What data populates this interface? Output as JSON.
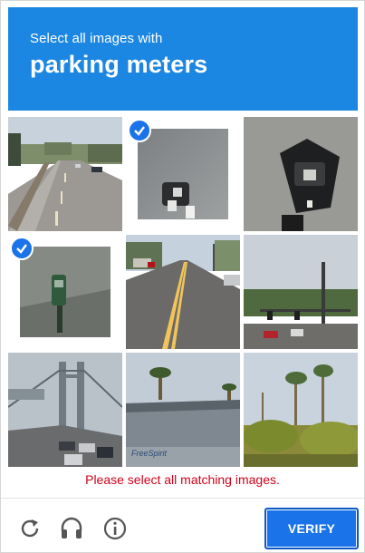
{
  "header": {
    "instruction": "Select all images with",
    "target": "parking meters",
    "background_color": "#1c87e2"
  },
  "tiles": [
    {
      "row": 1,
      "col": 1,
      "subject": "road with parked cars",
      "selected": false
    },
    {
      "row": 1,
      "col": 2,
      "subject": "parking meter close-up",
      "selected": true
    },
    {
      "row": 1,
      "col": 3,
      "subject": "parking meter close-up",
      "selected": false
    },
    {
      "row": 2,
      "col": 1,
      "subject": "green parking meter",
      "selected": true
    },
    {
      "row": 2,
      "col": 2,
      "subject": "city street",
      "selected": false
    },
    {
      "row": 2,
      "col": 3,
      "subject": "intersection with traffic lights",
      "selected": false
    },
    {
      "row": 3,
      "col": 1,
      "subject": "bridge with traffic",
      "selected": false
    },
    {
      "row": 3,
      "col": 2,
      "subject": "building with palm tree",
      "selected": false
    },
    {
      "row": 3,
      "col": 3,
      "subject": "palm trees",
      "selected": false
    }
  ],
  "error_message": "Please select all matching images.",
  "footer": {
    "reload_icon": "reload-icon",
    "audio_icon": "headphones-icon",
    "info_icon": "info-icon",
    "verify_label": "VERIFY",
    "accent_color": "#1a73e8",
    "error_color": "#d0021b"
  }
}
